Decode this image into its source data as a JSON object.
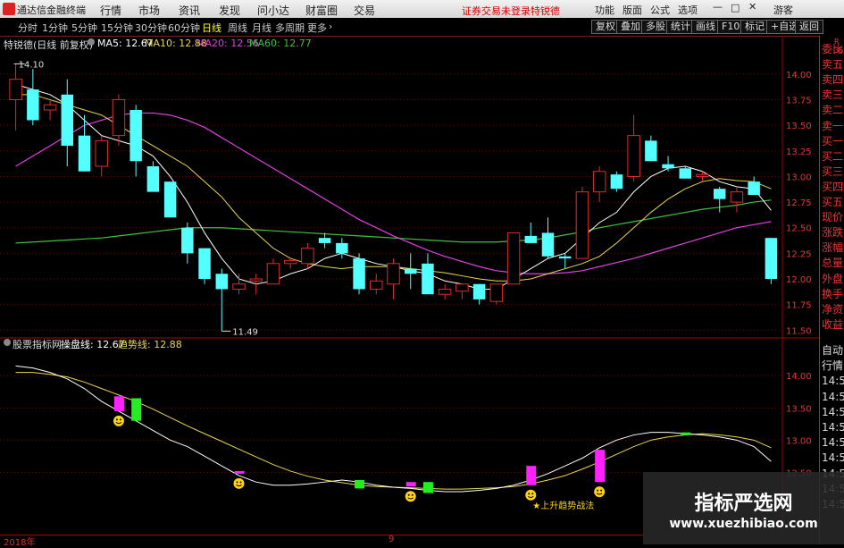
{
  "topbar": {
    "app_title": "通达信金融终端",
    "menus": [
      "行情",
      "市场",
      "资讯",
      "发现",
      "问小达",
      "财富圈",
      "交易"
    ],
    "warning": "证券交易未登录",
    "warning2": "特锐德",
    "right_menus": [
      "功能",
      "版面",
      "公式",
      "选项",
      "游客"
    ],
    "window_controls": [
      "minimize-icon",
      "maximize-icon",
      "close-icon"
    ]
  },
  "toolbar": {
    "periods": [
      "分时",
      "1分钟",
      "5分钟",
      "15分钟",
      "30分钟",
      "60分钟",
      "日线",
      "周线",
      "月线",
      "多周期",
      "更多"
    ],
    "active_period": "日线",
    "right_buttons": [
      "复权",
      "叠加",
      "多股",
      "统计",
      "画线",
      "F10",
      "标记",
      "+自选",
      "返回"
    ]
  },
  "main_panel": {
    "stock_label": "特锐德(日线 前复权)",
    "ma5": "MA5: 12.67",
    "ma10": "MA10: 12.88",
    "ma20": "MA20: 12.56",
    "ma60": "MA60: 12.77",
    "price_axis": [
      "14.00",
      "13.75",
      "13.50",
      "13.25",
      "13.00",
      "12.75",
      "12.50",
      "12.25",
      "12.00",
      "11.75",
      "11.50"
    ],
    "high_marker": "14.10",
    "low_marker": "11.49"
  },
  "sub_panel": {
    "indicator_label": "股票指标网",
    "line1": "操盘线: 12.67",
    "line2": "趋势线: 12.88",
    "axis": [
      "14.00",
      "13.50",
      "13.00",
      "12.50"
    ],
    "annotation": "上升趋势战法"
  },
  "side_panel": {
    "top_labels": [
      "R",
      "36"
    ],
    "labels": [
      "委比",
      "卖五",
      "卖四",
      "卖三",
      "卖二",
      "卖一",
      "买一",
      "买二",
      "买三",
      "买四",
      "买五",
      "现价",
      "涨跌",
      "涨幅",
      "总量",
      "外盘",
      "换手",
      "净资",
      "收益",
      "自动",
      "行情",
      "14:50",
      "14:50",
      "14:50",
      "14:50",
      "14:50",
      "14:50",
      "14:50",
      "14:50",
      "14:50"
    ]
  },
  "bottom": {
    "year": "2018年",
    "month": "9"
  },
  "watermark": {
    "title": "指标严选网",
    "url": "www.xuezhibiao.com"
  },
  "colors": {
    "up": "#e02a2a",
    "down": "#54ffff",
    "ma5": "#ffffff",
    "ma10": "#e8d84a",
    "ma20": "#e040e0",
    "ma60": "#40c040",
    "line1": "#ffffff",
    "line2": "#e8d84a",
    "mag_bar": "#ff22ff",
    "green_bar": "#22ee22"
  },
  "chart_data": {
    "type": "candlestick",
    "y_range": [
      11.45,
      14.2
    ],
    "candles": [
      {
        "o": 13.75,
        "h": 14.1,
        "l": 13.45,
        "c": 13.95
      },
      {
        "o": 13.85,
        "h": 14.05,
        "l": 13.5,
        "c": 13.55
      },
      {
        "o": 13.65,
        "h": 13.75,
        "l": 13.55,
        "c": 13.7
      },
      {
        "o": 13.8,
        "h": 13.95,
        "l": 13.1,
        "c": 13.3
      },
      {
        "o": 13.4,
        "h": 13.6,
        "l": 13.05,
        "c": 13.05
      },
      {
        "o": 13.1,
        "h": 13.4,
        "l": 13.0,
        "c": 13.35
      },
      {
        "o": 13.4,
        "h": 13.8,
        "l": 13.3,
        "c": 13.75
      },
      {
        "o": 13.65,
        "h": 13.7,
        "l": 13.0,
        "c": 13.15
      },
      {
        "o": 13.1,
        "h": 13.15,
        "l": 12.9,
        "c": 12.85
      },
      {
        "o": 12.95,
        "h": 12.95,
        "l": 12.65,
        "c": 12.6
      },
      {
        "o": 12.5,
        "h": 12.55,
        "l": 12.15,
        "c": 12.25
      },
      {
        "o": 12.3,
        "h": 12.3,
        "l": 11.95,
        "c": 12.0
      },
      {
        "o": 12.05,
        "h": 12.1,
        "l": 11.49,
        "c": 11.9
      },
      {
        "o": 11.9,
        "h": 12.05,
        "l": 11.85,
        "c": 11.95
      },
      {
        "o": 11.98,
        "h": 12.05,
        "l": 11.85,
        "c": 12.0
      },
      {
        "o": 11.95,
        "h": 12.2,
        "l": 11.95,
        "c": 12.15
      },
      {
        "o": 12.15,
        "h": 12.2,
        "l": 12.1,
        "c": 12.18
      },
      {
        "o": 12.15,
        "h": 12.35,
        "l": 12.1,
        "c": 12.3
      },
      {
        "o": 12.4,
        "h": 12.45,
        "l": 12.3,
        "c": 12.35
      },
      {
        "o": 12.35,
        "h": 12.4,
        "l": 12.2,
        "c": 12.25
      },
      {
        "o": 12.2,
        "h": 12.25,
        "l": 11.85,
        "c": 11.9
      },
      {
        "o": 11.9,
        "h": 12.05,
        "l": 11.85,
        "c": 11.98
      },
      {
        "o": 11.95,
        "h": 12.2,
        "l": 11.8,
        "c": 12.15
      },
      {
        "o": 12.1,
        "h": 12.25,
        "l": 11.9,
        "c": 12.05
      },
      {
        "o": 12.15,
        "h": 12.25,
        "l": 11.85,
        "c": 11.85
      },
      {
        "o": 11.85,
        "h": 11.95,
        "l": 11.8,
        "c": 11.9
      },
      {
        "o": 11.88,
        "h": 11.95,
        "l": 11.8,
        "c": 11.95
      },
      {
        "o": 11.95,
        "h": 11.95,
        "l": 11.75,
        "c": 11.8
      },
      {
        "o": 11.78,
        "h": 11.95,
        "l": 11.75,
        "c": 11.95
      },
      {
        "o": 11.95,
        "h": 12.45,
        "l": 11.95,
        "c": 12.45
      },
      {
        "o": 12.42,
        "h": 12.55,
        "l": 12.35,
        "c": 12.35
      },
      {
        "o": 12.45,
        "h": 12.6,
        "l": 12.2,
        "c": 12.22
      },
      {
        "o": 12.22,
        "h": 12.25,
        "l": 12.1,
        "c": 12.2
      },
      {
        "o": 12.2,
        "h": 12.9,
        "l": 12.2,
        "c": 12.85
      },
      {
        "o": 12.85,
        "h": 13.1,
        "l": 12.75,
        "c": 13.05
      },
      {
        "o": 13.02,
        "h": 13.05,
        "l": 12.85,
        "c": 12.88
      },
      {
        "o": 13.0,
        "h": 13.6,
        "l": 12.95,
        "c": 13.4
      },
      {
        "o": 13.35,
        "h": 13.4,
        "l": 13.15,
        "c": 13.15
      },
      {
        "o": 13.12,
        "h": 13.2,
        "l": 13.05,
        "c": 13.08
      },
      {
        "o": 13.08,
        "h": 13.1,
        "l": 12.98,
        "c": 12.98
      },
      {
        "o": 13.0,
        "h": 13.05,
        "l": 12.95,
        "c": 13.02
      },
      {
        "o": 12.88,
        "h": 12.9,
        "l": 12.65,
        "c": 12.78
      },
      {
        "o": 12.75,
        "h": 12.9,
        "l": 12.65,
        "c": 12.85
      },
      {
        "o": 12.95,
        "h": 13.0,
        "l": 12.85,
        "c": 12.82
      },
      {
        "o": 12.4,
        "h": 12.4,
        "l": 11.95,
        "c": 12.0
      }
    ],
    "ma5": [
      13.9,
      13.85,
      13.8,
      13.7,
      13.55,
      13.4,
      13.35,
      13.3,
      13.2,
      13.0,
      12.75,
      12.45,
      12.2,
      12.0,
      11.95,
      11.98,
      12.05,
      12.1,
      12.2,
      12.25,
      12.2,
      12.15,
      12.12,
      12.08,
      12.05,
      11.98,
      11.95,
      11.9,
      11.9,
      12.0,
      12.1,
      12.2,
      12.25,
      12.4,
      12.55,
      12.65,
      12.85,
      13.0,
      13.08,
      13.1,
      13.05,
      12.95,
      12.9,
      12.88,
      12.67
    ],
    "ma10": [
      13.8,
      13.8,
      13.75,
      13.7,
      13.65,
      13.6,
      13.5,
      13.4,
      13.3,
      13.2,
      13.1,
      12.95,
      12.8,
      12.6,
      12.45,
      12.3,
      12.2,
      12.15,
      12.12,
      12.1,
      12.12,
      12.12,
      12.12,
      12.1,
      12.08,
      12.06,
      12.03,
      12.0,
      11.98,
      11.98,
      12.0,
      12.05,
      12.1,
      12.15,
      12.22,
      12.35,
      12.5,
      12.65,
      12.78,
      12.88,
      12.95,
      12.98,
      12.96,
      12.95,
      12.88
    ],
    "ma20": [
      13.1,
      13.2,
      13.3,
      13.4,
      13.5,
      13.55,
      13.6,
      13.62,
      13.62,
      13.6,
      13.55,
      13.48,
      13.38,
      13.28,
      13.18,
      13.08,
      12.98,
      12.88,
      12.78,
      12.68,
      12.58,
      12.5,
      12.42,
      12.35,
      12.28,
      12.22,
      12.17,
      12.12,
      12.08,
      12.06,
      12.05,
      12.05,
      12.06,
      12.08,
      12.12,
      12.16,
      12.2,
      12.25,
      12.3,
      12.35,
      12.4,
      12.45,
      12.5,
      12.53,
      12.56
    ],
    "ma60": [
      12.35,
      12.36,
      12.37,
      12.38,
      12.39,
      12.4,
      12.42,
      12.44,
      12.46,
      12.48,
      12.5,
      12.5,
      12.5,
      12.49,
      12.48,
      12.47,
      12.46,
      12.45,
      12.44,
      12.43,
      12.42,
      12.41,
      12.4,
      12.39,
      12.38,
      12.37,
      12.36,
      12.36,
      12.36,
      12.37,
      12.38,
      12.4,
      12.43,
      12.46,
      12.5,
      12.53,
      12.56,
      12.59,
      12.62,
      12.65,
      12.68,
      12.7,
      12.72,
      12.75,
      12.77
    ],
    "sub_line1": [
      14.15,
      14.12,
      14.05,
      13.95,
      13.8,
      13.6,
      13.45,
      13.3,
      13.15,
      13.0,
      12.9,
      12.75,
      12.6,
      12.45,
      12.35,
      12.3,
      12.3,
      12.32,
      12.35,
      12.38,
      12.35,
      12.3,
      12.27,
      12.25,
      12.22,
      12.2,
      12.2,
      12.22,
      12.25,
      12.3,
      12.38,
      12.48,
      12.6,
      12.72,
      12.88,
      13.0,
      13.08,
      13.12,
      13.12,
      13.1,
      13.08,
      13.05,
      13.0,
      12.9,
      12.67
    ],
    "sub_line2": [
      14.05,
      14.05,
      14.02,
      13.98,
      13.9,
      13.8,
      13.7,
      13.6,
      13.48,
      13.35,
      13.22,
      13.1,
      12.98,
      12.86,
      12.74,
      12.62,
      12.52,
      12.44,
      12.38,
      12.34,
      12.3,
      12.28,
      12.27,
      12.26,
      12.25,
      12.24,
      12.24,
      12.25,
      12.26,
      12.28,
      12.32,
      12.38,
      12.45,
      12.55,
      12.66,
      12.78,
      12.9,
      13.0,
      13.05,
      13.08,
      13.1,
      13.08,
      13.05,
      13.0,
      12.88
    ],
    "sub_y_range": [
      12.2,
      14.35
    ],
    "sub_bars": [
      {
        "i": 6,
        "color": "mag",
        "from": 13.68,
        "to": 13.45,
        "smile": true
      },
      {
        "i": 7,
        "color": "green",
        "from": 13.65,
        "to": 13.3
      },
      {
        "i": 13,
        "color": "mag",
        "from": 12.52,
        "to": 12.48,
        "smile": true
      },
      {
        "i": 20,
        "color": "green",
        "from": 12.38,
        "to": 12.25
      },
      {
        "i": 23,
        "color": "mag",
        "from": 12.35,
        "to": 12.28,
        "smile": true
      },
      {
        "i": 24,
        "color": "green",
        "from": 12.35,
        "to": 12.18
      },
      {
        "i": 30,
        "color": "mag",
        "from": 12.6,
        "to": 12.3,
        "smile": true
      },
      {
        "i": 34,
        "color": "mag",
        "from": 12.85,
        "to": 12.35,
        "smile": true
      },
      {
        "i": 39,
        "color": "green",
        "from": 13.12,
        "to": 13.08
      }
    ]
  }
}
